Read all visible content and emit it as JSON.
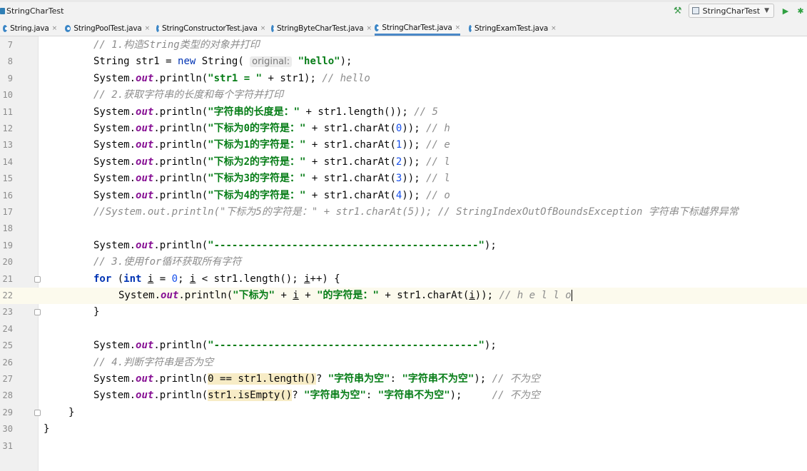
{
  "window": {
    "breadcrumb": "StringCharTest",
    "run_config": "StringCharTest"
  },
  "tabs": [
    {
      "label": "String.java",
      "active": false
    },
    {
      "label": "StringPoolTest.java",
      "active": false
    },
    {
      "label": "StringConstructorTest.java",
      "active": false
    },
    {
      "label": "StringByteCharTest.java",
      "active": false
    },
    {
      "label": "StringCharTest.java",
      "active": true
    },
    {
      "label": "StringExamTest.java",
      "active": false
    }
  ],
  "editor": {
    "current_line": 22,
    "lines": [
      {
        "n": "7",
        "s": [
          [
            "cmt",
            "// 1.构造String类型的对象并打印"
          ]
        ]
      },
      {
        "n": "8",
        "s": [
          [
            "",
            "String str1 = "
          ],
          [
            "kwn",
            "new"
          ],
          [
            "",
            " String( "
          ],
          [
            "hint",
            "original:"
          ],
          [
            "",
            " "
          ],
          [
            "str",
            "\"hello\""
          ],
          [
            "",
            ");"
          ]
        ]
      },
      {
        "n": "9",
        "s": [
          [
            "",
            "System."
          ],
          [
            "fld",
            "out"
          ],
          [
            "",
            ".println("
          ],
          [
            "str",
            "\"str1 = \""
          ],
          [
            "",
            " + str1); "
          ],
          [
            "cmt",
            "// hello"
          ]
        ]
      },
      {
        "n": "10",
        "s": [
          [
            "cmt",
            "// 2.获取字符串的长度和每个字符并打印"
          ]
        ]
      },
      {
        "n": "11",
        "s": [
          [
            "",
            "System."
          ],
          [
            "fld",
            "out"
          ],
          [
            "",
            ".println("
          ],
          [
            "str",
            "\"字符串的长度是：\""
          ],
          [
            "",
            " + str1.length()); "
          ],
          [
            "cmt",
            "// 5"
          ]
        ]
      },
      {
        "n": "12",
        "s": [
          [
            "",
            "System."
          ],
          [
            "fld",
            "out"
          ],
          [
            "",
            ".println("
          ],
          [
            "str",
            "\"下标为0的字符是：\""
          ],
          [
            "",
            " + str1.charAt("
          ],
          [
            "num",
            "0"
          ],
          [
            "",
            ")); "
          ],
          [
            "cmt",
            "// h"
          ]
        ]
      },
      {
        "n": "13",
        "s": [
          [
            "",
            "System."
          ],
          [
            "fld",
            "out"
          ],
          [
            "",
            ".println("
          ],
          [
            "str",
            "\"下标为1的字符是：\""
          ],
          [
            "",
            " + str1.charAt("
          ],
          [
            "num",
            "1"
          ],
          [
            "",
            ")); "
          ],
          [
            "cmt",
            "// e"
          ]
        ]
      },
      {
        "n": "14",
        "s": [
          [
            "",
            "System."
          ],
          [
            "fld",
            "out"
          ],
          [
            "",
            ".println("
          ],
          [
            "str",
            "\"下标为2的字符是：\""
          ],
          [
            "",
            " + str1.charAt("
          ],
          [
            "num",
            "2"
          ],
          [
            "",
            ")); "
          ],
          [
            "cmt",
            "// l"
          ]
        ]
      },
      {
        "n": "15",
        "s": [
          [
            "",
            "System."
          ],
          [
            "fld",
            "out"
          ],
          [
            "",
            ".println("
          ],
          [
            "str",
            "\"下标为3的字符是：\""
          ],
          [
            "",
            " + str1.charAt("
          ],
          [
            "num",
            "3"
          ],
          [
            "",
            ")); "
          ],
          [
            "cmt",
            "// l"
          ]
        ]
      },
      {
        "n": "16",
        "s": [
          [
            "",
            "System."
          ],
          [
            "fld",
            "out"
          ],
          [
            "",
            ".println("
          ],
          [
            "str",
            "\"下标为4的字符是：\""
          ],
          [
            "",
            " + str1.charAt("
          ],
          [
            "num",
            "4"
          ],
          [
            "",
            ")); "
          ],
          [
            "cmt",
            "// o"
          ]
        ]
      },
      {
        "n": "17",
        "s": [
          [
            "cmt",
            "//System.out.println(\"下标为5的字符是：\" + str1.charAt(5)); // StringIndexOutOfBoundsException 字符串下标越界异常"
          ]
        ]
      },
      {
        "n": "18",
        "s": []
      },
      {
        "n": "19",
        "s": [
          [
            "",
            "System."
          ],
          [
            "fld",
            "out"
          ],
          [
            "",
            ".println("
          ],
          [
            "str",
            "\"--------------------------------------------\""
          ],
          [
            "",
            ");"
          ]
        ]
      },
      {
        "n": "20",
        "s": [
          [
            "cmt",
            "// 3.使用for循环获取所有字符"
          ]
        ]
      },
      {
        "n": "21",
        "s": [
          [
            "kw",
            "for"
          ],
          [
            "",
            " ("
          ],
          [
            "kw",
            "int"
          ],
          [
            "",
            " "
          ],
          [
            "ul",
            "i"
          ],
          [
            "",
            " = "
          ],
          [
            "num",
            "0"
          ],
          [
            "",
            "; "
          ],
          [
            "ul",
            "i"
          ],
          [
            "",
            " < str1.length(); "
          ],
          [
            "ul",
            "i"
          ],
          [
            "",
            "++) {"
          ]
        ]
      },
      {
        "n": "22",
        "s": [
          [
            "",
            "System."
          ],
          [
            "fld",
            "out"
          ],
          [
            "",
            ".println("
          ],
          [
            "str",
            "\"下标为\""
          ],
          [
            "",
            " + "
          ],
          [
            "ul",
            "i"
          ],
          [
            "",
            " + "
          ],
          [
            "str",
            "\"的字符是：\""
          ],
          [
            "",
            " + str1.charAt("
          ],
          [
            "ul",
            "i"
          ],
          [
            "",
            ")); "
          ],
          [
            "cmt",
            "// h e l l o"
          ]
        ]
      },
      {
        "n": "23",
        "s": [
          [
            "",
            "}"
          ]
        ]
      },
      {
        "n": "24",
        "s": []
      },
      {
        "n": "25",
        "s": [
          [
            "",
            "System."
          ],
          [
            "fld",
            "out"
          ],
          [
            "",
            ".println("
          ],
          [
            "str",
            "\"--------------------------------------------\""
          ],
          [
            "",
            ");"
          ]
        ]
      },
      {
        "n": "26",
        "s": [
          [
            "cmt",
            "// 4.判断字符串是否为空"
          ]
        ]
      },
      {
        "n": "27",
        "s": [
          [
            "",
            "System."
          ],
          [
            "fld",
            "out"
          ],
          [
            "",
            ".println("
          ],
          [
            "hl",
            "0 == str1.length()"
          ],
          [
            "",
            "? "
          ],
          [
            "str",
            "\"字符串为空\""
          ],
          [
            "",
            ": "
          ],
          [
            "str",
            "\"字符串不为空\""
          ],
          [
            "",
            "); "
          ],
          [
            "cmt",
            "// 不为空"
          ]
        ]
      },
      {
        "n": "28",
        "s": [
          [
            "",
            "System."
          ],
          [
            "fld",
            "out"
          ],
          [
            "",
            ".println("
          ],
          [
            "hl",
            "str1.isEmpty()"
          ],
          [
            "",
            "? "
          ],
          [
            "str",
            "\"字符串为空\""
          ],
          [
            "",
            ": "
          ],
          [
            "str",
            "\"字符串不为空\""
          ],
          [
            "",
            ");     "
          ],
          [
            "cmt",
            "// 不为空"
          ]
        ]
      },
      {
        "n": "29",
        "s": [
          [
            "",
            "}"
          ]
        ]
      },
      {
        "n": "30",
        "s": [
          [
            "",
            "}"
          ]
        ]
      },
      {
        "n": "31",
        "s": []
      }
    ]
  }
}
